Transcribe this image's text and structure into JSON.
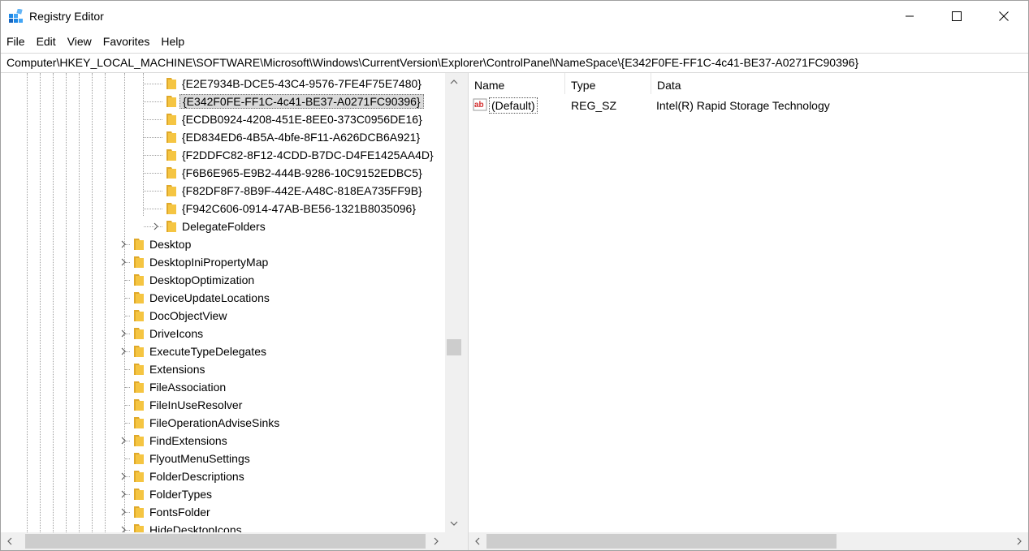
{
  "window": {
    "title": "Registry Editor",
    "icon": "registry-icon"
  },
  "menu": [
    "File",
    "Edit",
    "View",
    "Favorites",
    "Help"
  ],
  "address": "Computer\\HKEY_LOCAL_MACHINE\\SOFTWARE\\Microsoft\\Windows\\CurrentVersion\\Explorer\\ControlPanel\\NameSpace\\{E342F0FE-FF1C-4c41-BE37-A0271FC90396}",
  "tree": {
    "items": [
      {
        "label": "{E2E7934B-DCE5-43C4-9576-7FE4F75E7480}",
        "level": 2,
        "expandable": false,
        "selected": false
      },
      {
        "label": "{E342F0FE-FF1C-4c41-BE37-A0271FC90396}",
        "level": 2,
        "expandable": false,
        "selected": true
      },
      {
        "label": "{ECDB0924-4208-451E-8EE0-373C0956DE16}",
        "level": 2,
        "expandable": false,
        "selected": false
      },
      {
        "label": "{ED834ED6-4B5A-4bfe-8F11-A626DCB6A921}",
        "level": 2,
        "expandable": false,
        "selected": false
      },
      {
        "label": "{F2DDFC82-8F12-4CDD-B7DC-D4FE1425AA4D}",
        "level": 2,
        "expandable": false,
        "selected": false
      },
      {
        "label": "{F6B6E965-E9B2-444B-9286-10C9152EDBC5}",
        "level": 2,
        "expandable": false,
        "selected": false
      },
      {
        "label": "{F82DF8F7-8B9F-442E-A48C-818EA735FF9B}",
        "level": 2,
        "expandable": false,
        "selected": false
      },
      {
        "label": "{F942C606-0914-47AB-BE56-1321B8035096}",
        "level": 2,
        "expandable": false,
        "selected": false
      },
      {
        "label": "DelegateFolders",
        "level": 2,
        "expandable": true,
        "selected": false
      },
      {
        "label": "Desktop",
        "level": 1,
        "expandable": true,
        "selected": false
      },
      {
        "label": "DesktopIniPropertyMap",
        "level": 1,
        "expandable": true,
        "selected": false
      },
      {
        "label": "DesktopOptimization",
        "level": 1,
        "expandable": false,
        "selected": false
      },
      {
        "label": "DeviceUpdateLocations",
        "level": 1,
        "expandable": false,
        "selected": false
      },
      {
        "label": "DocObjectView",
        "level": 1,
        "expandable": false,
        "selected": false
      },
      {
        "label": "DriveIcons",
        "level": 1,
        "expandable": true,
        "selected": false
      },
      {
        "label": "ExecuteTypeDelegates",
        "level": 1,
        "expandable": true,
        "selected": false
      },
      {
        "label": "Extensions",
        "level": 1,
        "expandable": false,
        "selected": false
      },
      {
        "label": "FileAssociation",
        "level": 1,
        "expandable": false,
        "selected": false
      },
      {
        "label": "FileInUseResolver",
        "level": 1,
        "expandable": false,
        "selected": false
      },
      {
        "label": "FileOperationAdviseSinks",
        "level": 1,
        "expandable": false,
        "selected": false
      },
      {
        "label": "FindExtensions",
        "level": 1,
        "expandable": true,
        "selected": false
      },
      {
        "label": "FlyoutMenuSettings",
        "level": 1,
        "expandable": false,
        "selected": false
      },
      {
        "label": "FolderDescriptions",
        "level": 1,
        "expandable": true,
        "selected": false
      },
      {
        "label": "FolderTypes",
        "level": 1,
        "expandable": true,
        "selected": false
      },
      {
        "label": "FontsFolder",
        "level": 1,
        "expandable": true,
        "selected": false
      },
      {
        "label": "HideDesktopIcons",
        "level": 1,
        "expandable": true,
        "selected": false
      }
    ]
  },
  "values": {
    "columns": {
      "name": "Name",
      "type": "Type",
      "data": "Data"
    },
    "rows": [
      {
        "name": "(Default)",
        "type": "REG_SZ",
        "data": "Intel(R) Rapid Storage Technology",
        "icon": "string-value-icon"
      }
    ]
  },
  "colors": {
    "folder": "#f5c542",
    "selected_bg": "#d9d9d9",
    "scroll_track": "#f0f0f0",
    "scroll_thumb": "#cdcdcd"
  }
}
